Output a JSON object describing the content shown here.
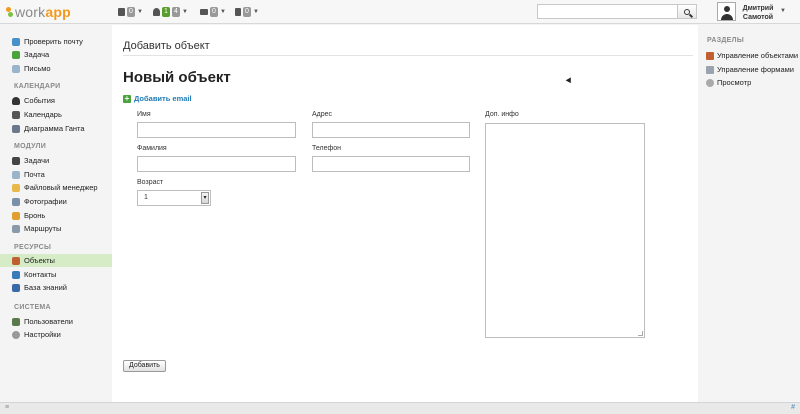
{
  "app": {
    "logo_prefix": "work",
    "logo_suffix": "app"
  },
  "topbar": {
    "counters": [
      {
        "icon": "list-icon",
        "values": [
          "0"
        ]
      },
      {
        "icon": "user-icon",
        "values": [
          "1",
          "4"
        ]
      },
      {
        "icon": "chat-icon",
        "values": [
          "0"
        ]
      },
      {
        "icon": "trash-icon",
        "values": [
          "0"
        ]
      }
    ],
    "search": {
      "placeholder": "",
      "value": ""
    },
    "user": {
      "first": "Дмитрий",
      "last": "Самотой"
    }
  },
  "sidebar": {
    "top_items": [
      {
        "label": "Проверить почту",
        "icon": "mail-check-icon",
        "color": "#4a90c8"
      },
      {
        "label": "Задача",
        "icon": "task-add-icon",
        "color": "#4aa33c"
      },
      {
        "label": "Письмо",
        "icon": "letter-icon",
        "color": "#9ab4cc"
      }
    ],
    "sections": [
      {
        "title": "КАЛЕНДАРИ",
        "items": [
          {
            "label": "События",
            "icon": "events-icon",
            "color": "#333333"
          },
          {
            "label": "Календарь",
            "icon": "calendar-icon",
            "color": "#555555"
          },
          {
            "label": "Диаграмма Ганта",
            "icon": "gantt-icon",
            "color": "#6a7a8a"
          }
        ]
      },
      {
        "title": "МОДУЛИ",
        "items": [
          {
            "label": "Задачи",
            "icon": "tasks-icon",
            "color": "#444444"
          },
          {
            "label": "Почта",
            "icon": "mail-icon",
            "color": "#9ab4cc"
          },
          {
            "label": "Файловый менеджер",
            "icon": "folder-icon",
            "color": "#e8b84a"
          },
          {
            "label": "Фотографии",
            "icon": "photos-icon",
            "color": "#7a8fa8"
          },
          {
            "label": "Бронь",
            "icon": "booking-icon",
            "color": "#e0a030"
          },
          {
            "label": "Маршруты",
            "icon": "routes-icon",
            "color": "#8a9aa8"
          }
        ]
      },
      {
        "title": "РЕСУРСЫ",
        "items": [
          {
            "label": "Объекты",
            "icon": "objects-icon",
            "color": "#c06030",
            "active": true
          },
          {
            "label": "Контакты",
            "icon": "contacts-icon",
            "color": "#3a7ab8"
          },
          {
            "label": "База знаний",
            "icon": "knowledge-icon",
            "color": "#3a6aa8"
          }
        ]
      },
      {
        "title": "СИСТЕМА",
        "items": [
          {
            "label": "Пользователи",
            "icon": "users-icon",
            "color": "#5a7a4a"
          },
          {
            "label": "Настройки",
            "icon": "settings-icon",
            "color": "#999999"
          }
        ]
      }
    ]
  },
  "main": {
    "page_title": "Добавить объект",
    "form_title": "Новый объект",
    "add_email": "Добавить email",
    "fields": {
      "first_name": {
        "label": "Имя",
        "value": ""
      },
      "last_name": {
        "label": "Фамилия",
        "value": ""
      },
      "address": {
        "label": "Адрес",
        "value": ""
      },
      "phone": {
        "label": "Телефон",
        "value": ""
      },
      "age": {
        "label": "Возраст",
        "value": "1"
      },
      "info": {
        "label": "Доп. инфо",
        "value": ""
      }
    },
    "submit": "Добавить"
  },
  "rightpanel": {
    "title": "РАЗДЕЛЫ",
    "items": [
      {
        "label": "Управление объектами",
        "icon": "manage-objects-icon",
        "color": "#c06030"
      },
      {
        "label": "Управление формами",
        "icon": "manage-forms-icon",
        "color": "#9aa4ae"
      },
      {
        "label": "Просмотр",
        "icon": "view-icon",
        "color": "#aaaaaa"
      }
    ]
  },
  "bottombar": {
    "left": "≡",
    "right": "#"
  }
}
